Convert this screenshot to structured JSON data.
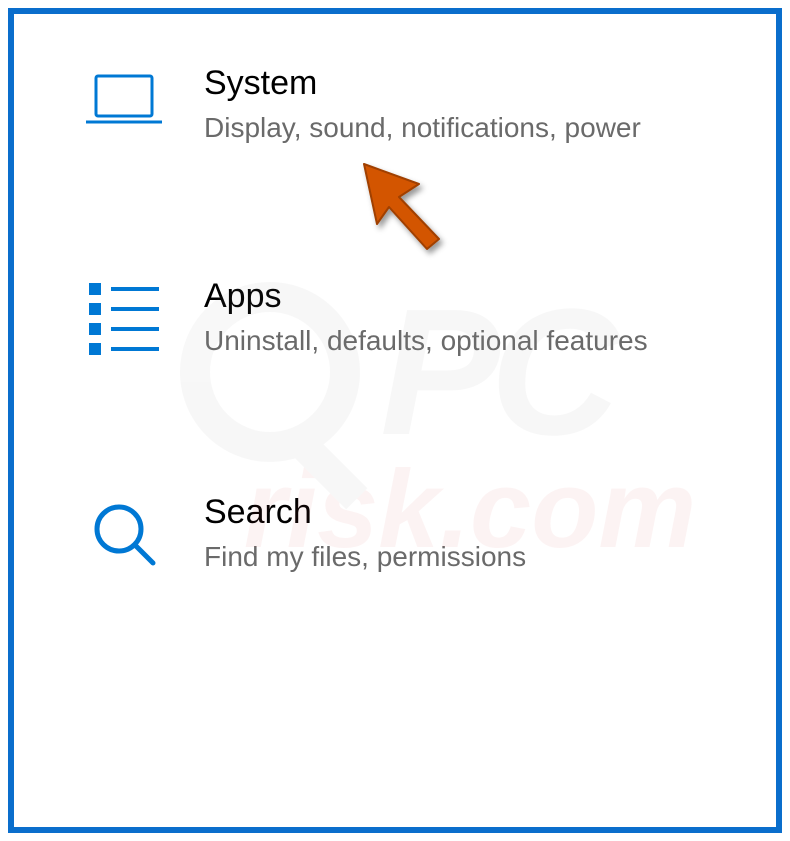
{
  "settings": {
    "items": [
      {
        "icon": "laptop",
        "title": "System",
        "desc": "Display, sound, notifications, power"
      },
      {
        "icon": "apps",
        "title": "Apps",
        "desc": "Uninstall, defaults, optional features"
      },
      {
        "icon": "search",
        "title": "Search",
        "desc": "Find my files, permissions"
      }
    ]
  },
  "colors": {
    "accent": "#0078d4",
    "border": "#0a6ecc",
    "text_primary": "#000000",
    "text_secondary": "#6a6a6a",
    "arrow": "#d35400"
  },
  "watermark": {
    "top": "PC",
    "bottom": "risk.com"
  }
}
